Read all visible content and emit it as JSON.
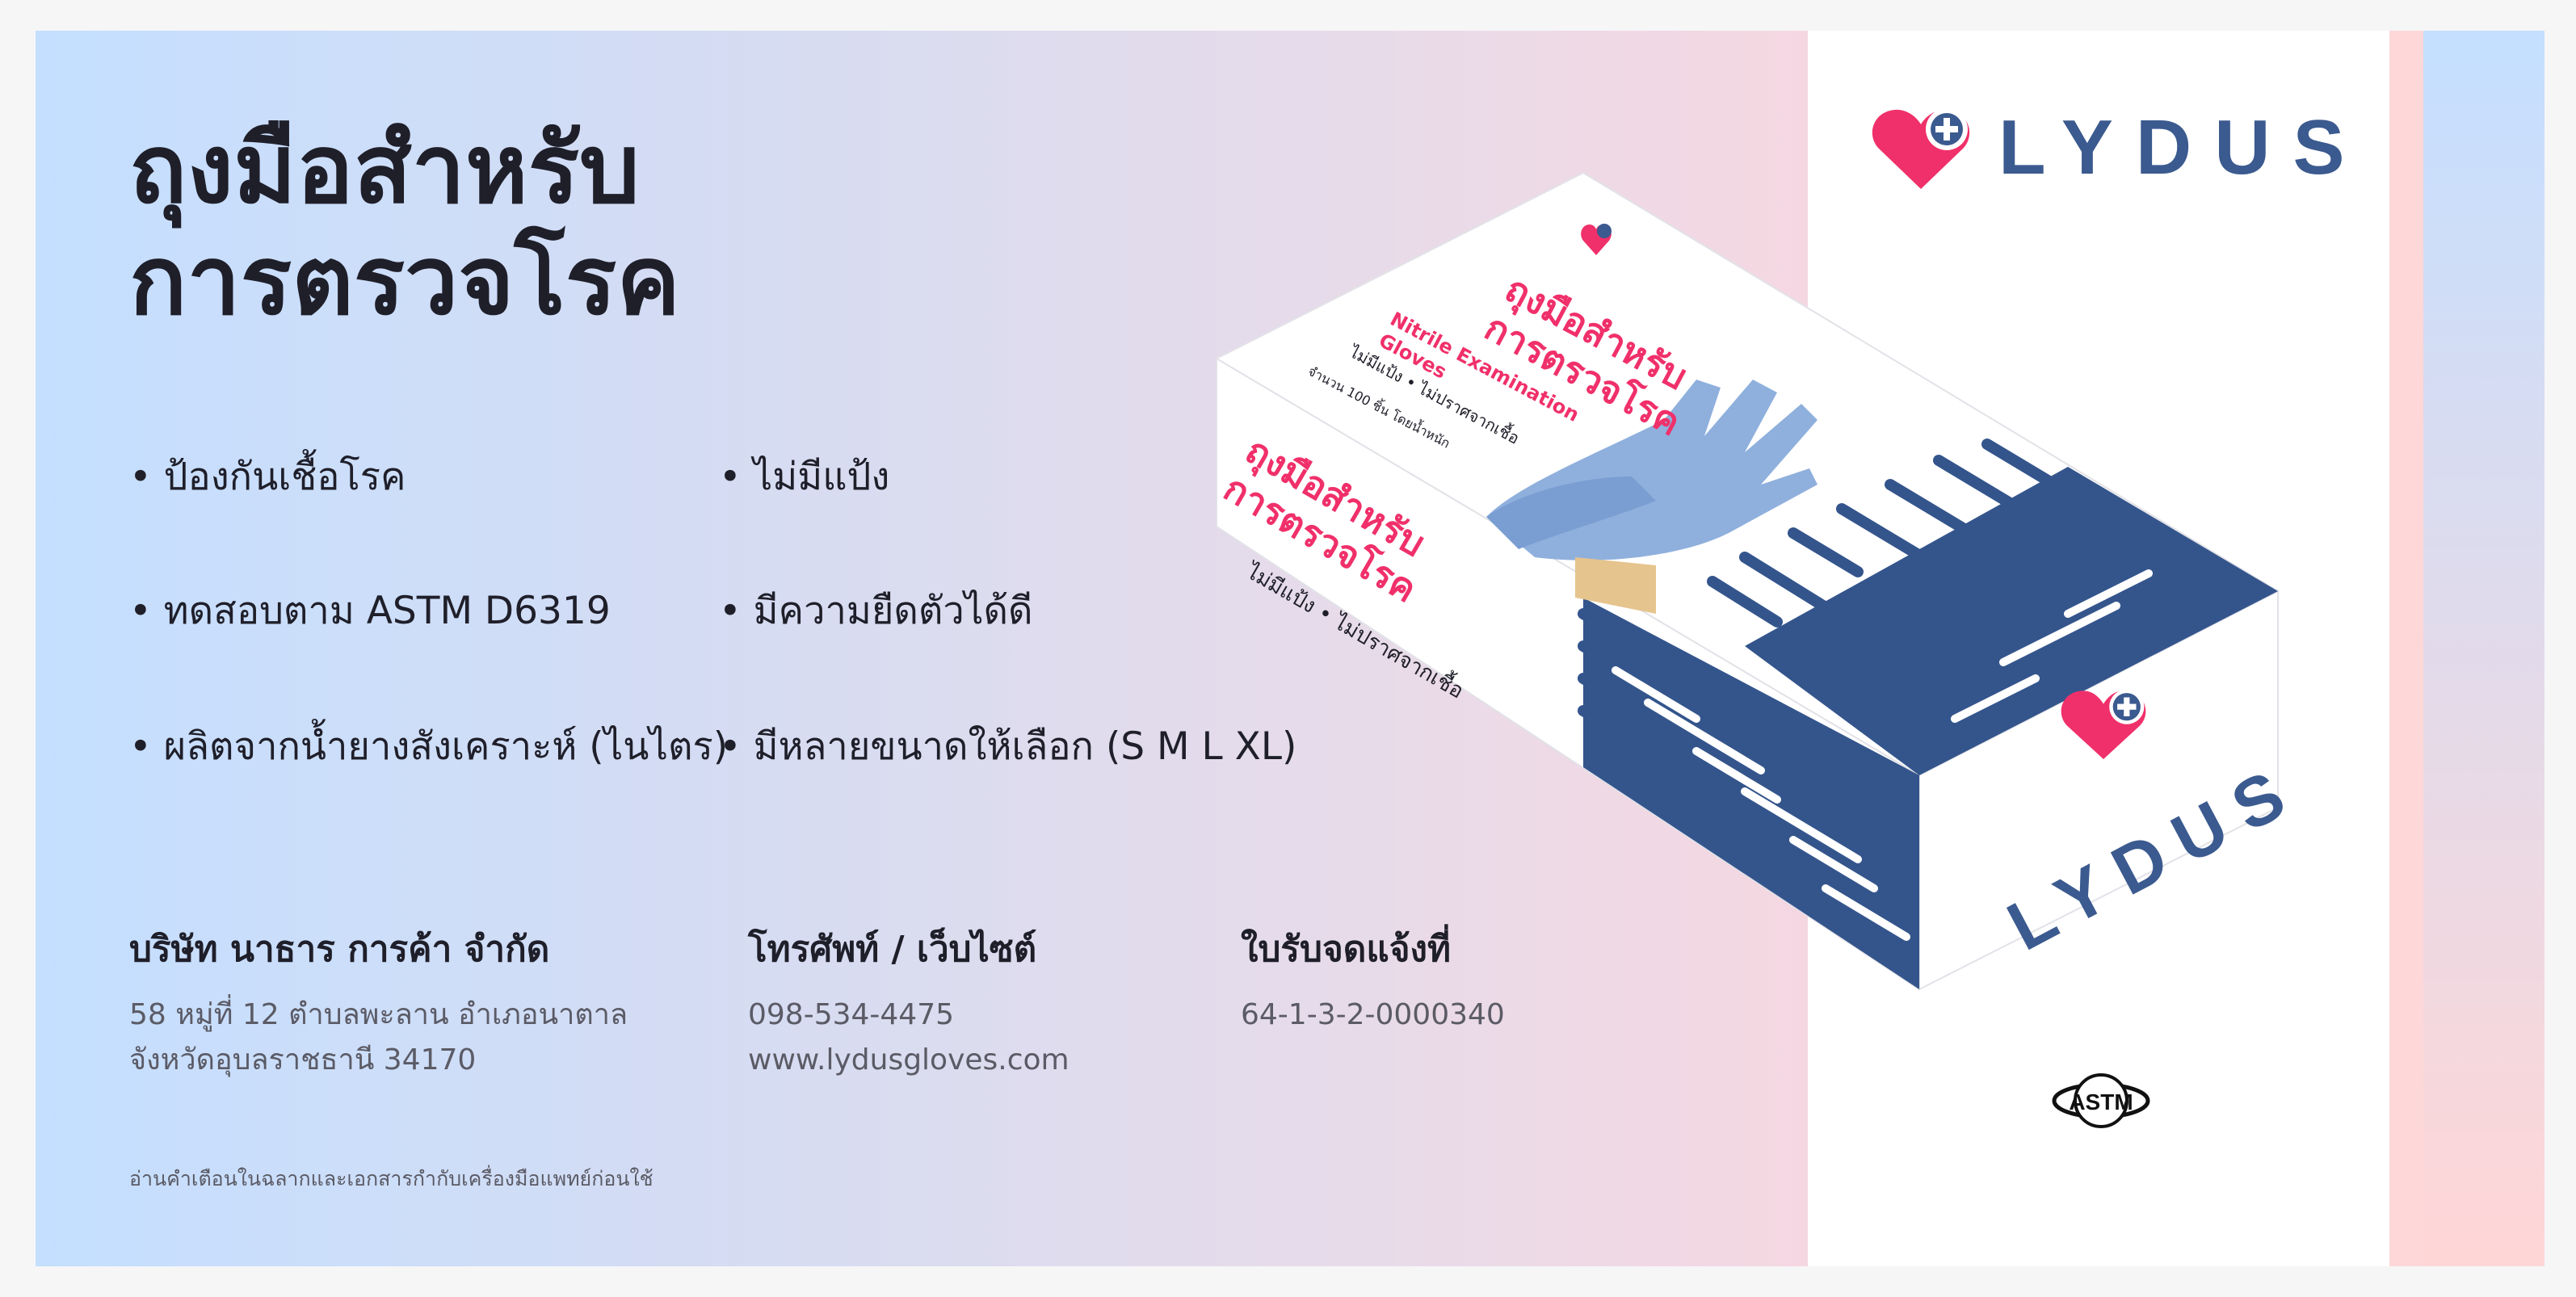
{
  "headline": "ถุงมือสำหรับ\nการตรวจโรค",
  "features": [
    "• ป้องกันเชื้อโรค",
    "• ไม่มีแป้ง",
    "• ทดสอบตาม ASTM D6319",
    "• มีความยืดตัวได้ดี",
    "• ผลิตจากน้ำยางสังเคราะห์ (ไนไตร)",
    "• มีหลายขนาดให้เลือก (S M L XL)"
  ],
  "company": {
    "heading": "บริษัท นาธาร การค้า จำกัด",
    "address_line1": "58 หมู่ที่ 12  ตำบลพะลาน อำเภอนาตาล",
    "address_line2": "จังหวัดอุบลราชธานี 34170"
  },
  "contact": {
    "heading": "โทรศัพท์ / เว็บไซต์",
    "phone": "098-534-4475",
    "website": "www.lydusgloves.com"
  },
  "registration": {
    "heading": "ใบรับจดแจ้งที่",
    "number": "64-1-3-2-0000340"
  },
  "disclaimer": "อ่านคำเตือนในฉลากและเอกสารกำกับเครื่องมือแพทย์ก่อนใช้",
  "brand": {
    "name": "LYDUS",
    "logo_icon": "heart-plus-icon"
  },
  "box": {
    "top_title_line1": "ถุงมือสำหรับ",
    "top_title_line2": "การตรวจโรค",
    "top_subtitle_line1": "Nitrile Examination",
    "top_subtitle_line2": "Gloves",
    "top_feature": "ไม่มีแป้ง • ไม่ปราศจากเชื้อ",
    "top_quantity": "จำนวน 100 ชิ้น โดยน้ำหนัก",
    "front_title_line1": "ถุงมือสำหรับ",
    "front_title_line2": "การตรวจโรค",
    "front_feature": "ไม่มีแป้ง • ไม่ปราศจากเชื้อ",
    "side_brand": "LYDUS"
  },
  "certification": "ASTM",
  "colors": {
    "accent": "#f0306a",
    "brand_blue": "#3b5a8f",
    "text_dark": "#1f1f2a",
    "text_muted": "#5b5b66",
    "glove": "#8fb0dd"
  }
}
